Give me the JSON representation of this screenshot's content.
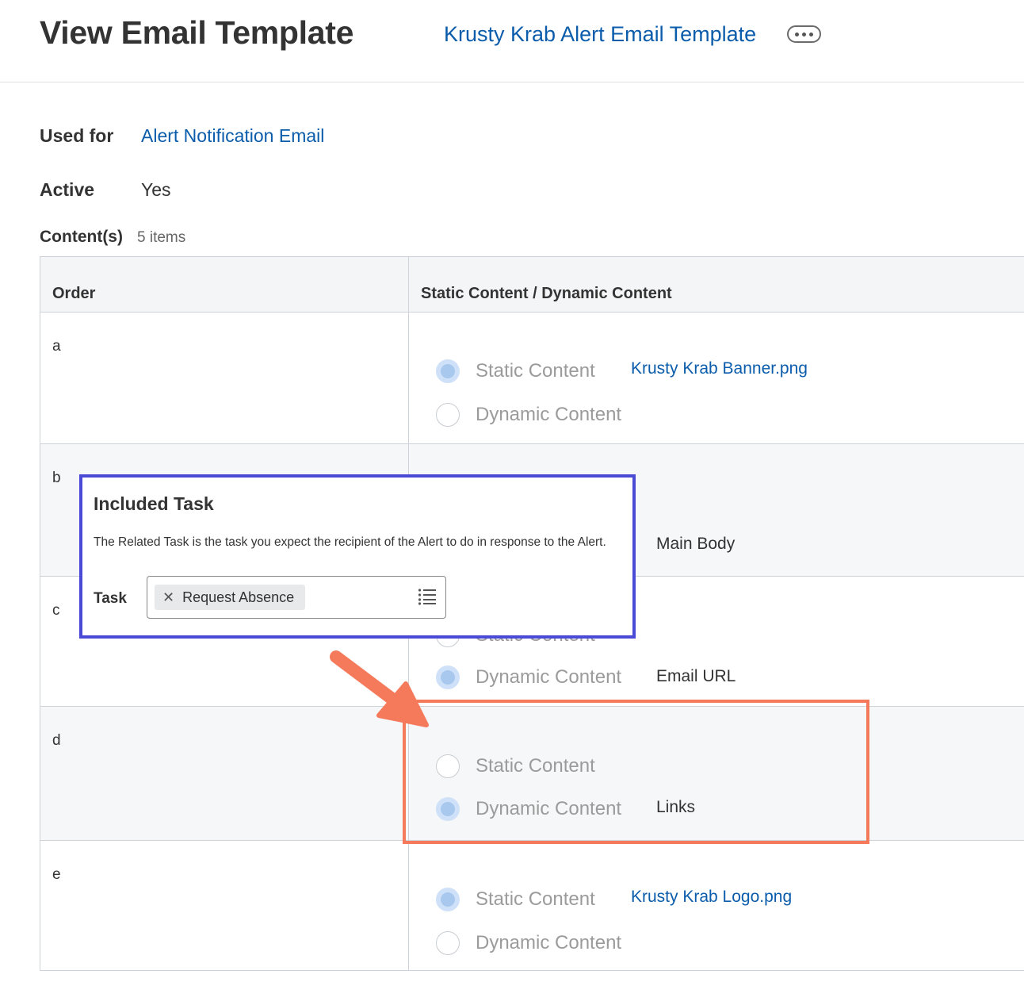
{
  "header": {
    "title": "View Email Template",
    "template_link": "Krusty Krab Alert Email Template",
    "more_icon": "ellipsis-icon"
  },
  "fields": {
    "used_for_label": "Used for",
    "used_for_value": "Alert Notification Email",
    "active_label": "Active",
    "active_value": "Yes",
    "contents_label": "Content(s)",
    "contents_count": "5 items"
  },
  "grid": {
    "columns": [
      "Order",
      "Static Content / Dynamic Content"
    ],
    "rows": [
      {
        "order": "a",
        "static_label": "Static Content",
        "dynamic_label": "Dynamic Content",
        "selected": "static",
        "content": "Krusty Krab Banner.png"
      },
      {
        "order": "b",
        "static_label": "",
        "dynamic_label": "",
        "selected": "dynamic",
        "content": "Main Body"
      },
      {
        "order": "c",
        "static_label": "Static Content",
        "dynamic_label": "Dynamic Content",
        "selected": "dynamic",
        "content": "Email URL"
      },
      {
        "order": "d",
        "static_label": "Static Content",
        "dynamic_label": "Dynamic Content",
        "selected": "dynamic",
        "content": "Links"
      },
      {
        "order": "e",
        "static_label": "Static Content",
        "dynamic_label": "Dynamic Content",
        "selected": "static",
        "content": "Krusty Krab Logo.png"
      }
    ]
  },
  "popup": {
    "title": "Included Task",
    "description": "The Related Task is the task you expect the recipient of the Alert to do in response to the Alert.",
    "task_label": "Task",
    "task_value": "Request Absence",
    "remove_icon": "close-icon",
    "list_icon": "list-icon"
  },
  "colors": {
    "link": "#0b5cab",
    "popup_border": "#4a4ad6",
    "highlight_border": "#f47a5b",
    "arrow": "#f47a5b"
  }
}
